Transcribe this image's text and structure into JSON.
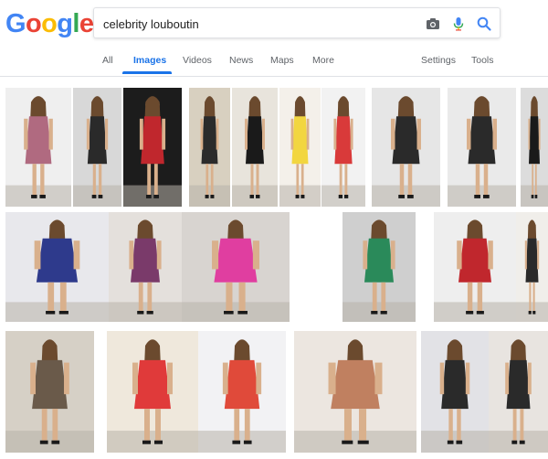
{
  "logo": {
    "text": "Google",
    "letters": [
      "G",
      "o",
      "o",
      "g",
      "l",
      "e"
    ],
    "colors": [
      "#4285F4",
      "#EA4335",
      "#FBBC05",
      "#4285F4",
      "#34A853",
      "#EA4335"
    ]
  },
  "search": {
    "query": "celebrity louboutin",
    "icons": [
      "camera-icon",
      "microphone-icon",
      "search-icon"
    ]
  },
  "nav": {
    "tabs": [
      {
        "label": "All"
      },
      {
        "label": "Images"
      },
      {
        "label": "Videos"
      },
      {
        "label": "News"
      },
      {
        "label": "Maps"
      },
      {
        "label": "More"
      }
    ],
    "active_tab": "Images",
    "settings": "Settings",
    "tools": "Tools"
  },
  "colors": {
    "accent": "#1a73e8",
    "nav_text": "#5f6368",
    "border": "#dfe1e5"
  },
  "results": {
    "count": 22,
    "thumbnails": [
      {
        "row": 1,
        "dominant_color": "#b06a80"
      },
      {
        "row": 1,
        "dominant_color": "#2a2a2a"
      },
      {
        "row": 1,
        "dominant_color": "#c0272d"
      },
      {
        "row": 1,
        "dominant_color": "#2b2b2b"
      },
      {
        "row": 1,
        "dominant_color": "#1a1a1a"
      },
      {
        "row": 1,
        "dominant_color": "#f2d640"
      },
      {
        "row": 1,
        "dominant_color": "#d93a3a"
      },
      {
        "row": 1,
        "dominant_color": "#2a2a2a"
      },
      {
        "row": 1,
        "dominant_color": "#2a2a2a"
      },
      {
        "row": 1,
        "dominant_color": "#1a1a1a"
      },
      {
        "row": 2,
        "dominant_color": "#2e3a8c"
      },
      {
        "row": 2,
        "dominant_color": "#7a3a6a"
      },
      {
        "row": 2,
        "dominant_color": "#e03ea0"
      },
      {
        "row": 2,
        "dominant_color": "#2a8a5a"
      },
      {
        "row": 2,
        "dominant_color": "#c0272d"
      },
      {
        "row": 2,
        "dominant_color": "#2a2a2a"
      },
      {
        "row": 3,
        "dominant_color": "#6a5a4a"
      },
      {
        "row": 3,
        "dominant_color": "#e03a3a"
      },
      {
        "row": 3,
        "dominant_color": "#e04a3a"
      },
      {
        "row": 3,
        "dominant_color": "#c08060"
      },
      {
        "row": 3,
        "dominant_color": "#2a2a2a"
      },
      {
        "row": 3,
        "dominant_color": "#2a2a2a"
      }
    ]
  }
}
